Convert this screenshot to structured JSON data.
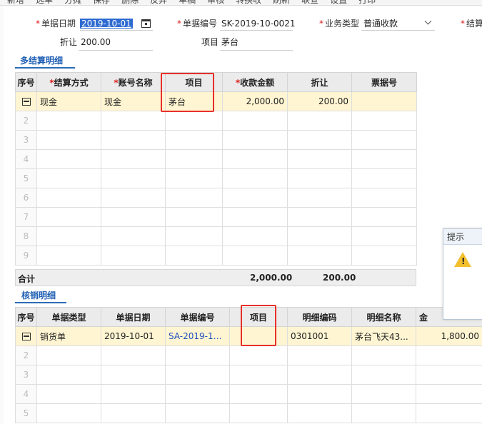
{
  "toolbar": {
    "items": [
      "新增",
      "选单",
      "分摊",
      "保存",
      "删除",
      "反弃",
      "单稿",
      "审核",
      "转换收",
      "刷新",
      "联查",
      "设置",
      "打印"
    ]
  },
  "form": {
    "date_label": "单据日期",
    "date_value": "2019-10-01",
    "bill_no_label": "单据编号",
    "bill_no_value": "SK-2019-10-0021",
    "biz_type_label": "业务类型",
    "biz_type_value": "普通收款",
    "settle_label_partial": "结算",
    "discount_label": "折让",
    "discount_value": "200.00",
    "project_label": "项目",
    "project_value": "茅台"
  },
  "settlement": {
    "title": "多结算明细",
    "columns": [
      "序号",
      "结算方式",
      "账号名称",
      "项目",
      "收款金额",
      "折让",
      "票据号"
    ],
    "required_cols": [
      false,
      true,
      true,
      false,
      true,
      false,
      false
    ],
    "row1": {
      "method": "现金",
      "account": "现金",
      "project": "茅台",
      "amount": "2,000.00",
      "discount": "200.00",
      "ticket": ""
    },
    "empty_rows": [
      "2",
      "3",
      "4",
      "5",
      "6",
      "7",
      "8",
      "9"
    ],
    "total_label": "合计",
    "total_amount": "2,000.00",
    "total_discount": "200.00"
  },
  "writeoff": {
    "title": "核销明细",
    "columns": [
      "序号",
      "单据类型",
      "单据日期",
      "单据编号",
      "项目",
      "明细编码",
      "明细名称",
      "金"
    ],
    "row1": {
      "type": "销货单",
      "date": "2019-10-01",
      "bill_no": "SA-2019-10-...",
      "project": "",
      "code": "0301001",
      "name": "茅台飞天43...",
      "amount": "1,800.00"
    },
    "empty_rows": [
      "2",
      "3",
      "4",
      "5"
    ]
  },
  "tip_dialog": {
    "title": "提示",
    "icon": "warning-icon"
  },
  "colors": {
    "accent": "#2a6cb6",
    "highlight_row": "#fff5d2",
    "red_box": "#e8302a",
    "required": "#e02020"
  }
}
